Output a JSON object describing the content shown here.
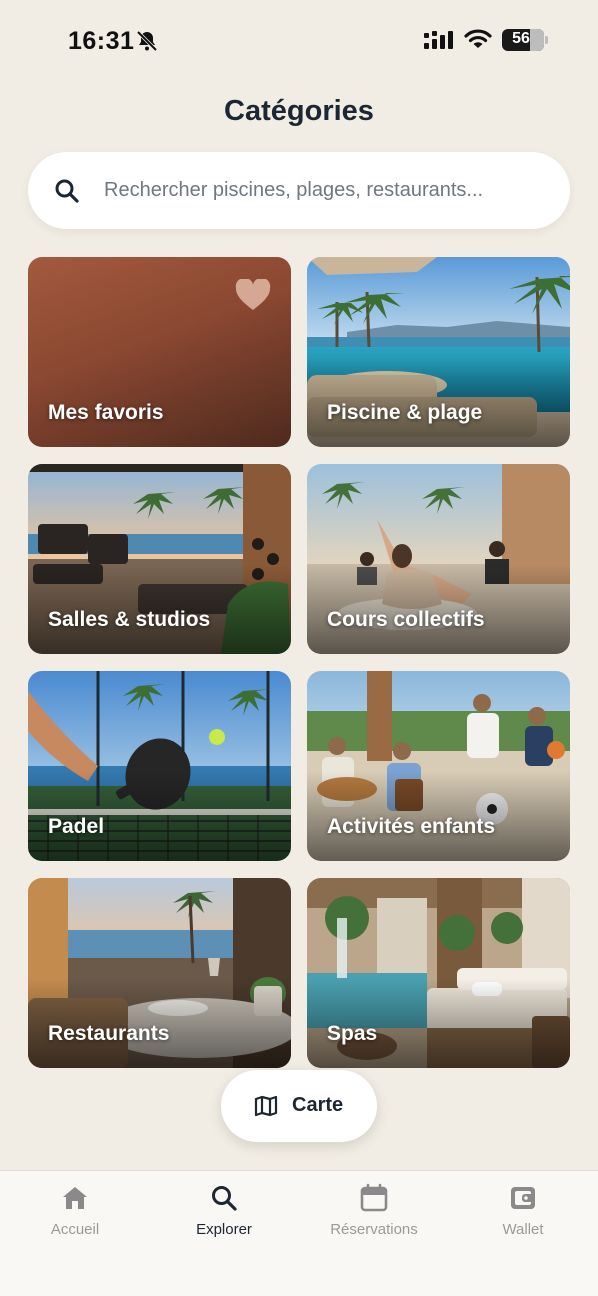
{
  "status_bar": {
    "time": "16:31",
    "battery": "56"
  },
  "page_title": "Catégories",
  "search": {
    "placeholder": "Rechercher piscines, plages, restaurants..."
  },
  "categories": [
    {
      "label": "Mes favoris"
    },
    {
      "label": "Piscine & plage"
    },
    {
      "label": "Salles & studios"
    },
    {
      "label": "Cours collectifs"
    },
    {
      "label": "Padel"
    },
    {
      "label": "Activités enfants"
    },
    {
      "label": "Restaurants"
    },
    {
      "label": "Spas"
    }
  ],
  "map_button": {
    "label": "Carte"
  },
  "bottom_nav": [
    {
      "label": "Accueil",
      "icon": "home-icon"
    },
    {
      "label": "Explorer",
      "icon": "search-icon",
      "active": true
    },
    {
      "label": "Réservations",
      "icon": "calendar-icon"
    },
    {
      "label": "Wallet",
      "icon": "wallet-icon"
    }
  ],
  "colors": {
    "background": "#f1ece4",
    "text": "#1c2733",
    "inactive": "#9a9a9a",
    "favorite_tile": "#8a4731"
  }
}
